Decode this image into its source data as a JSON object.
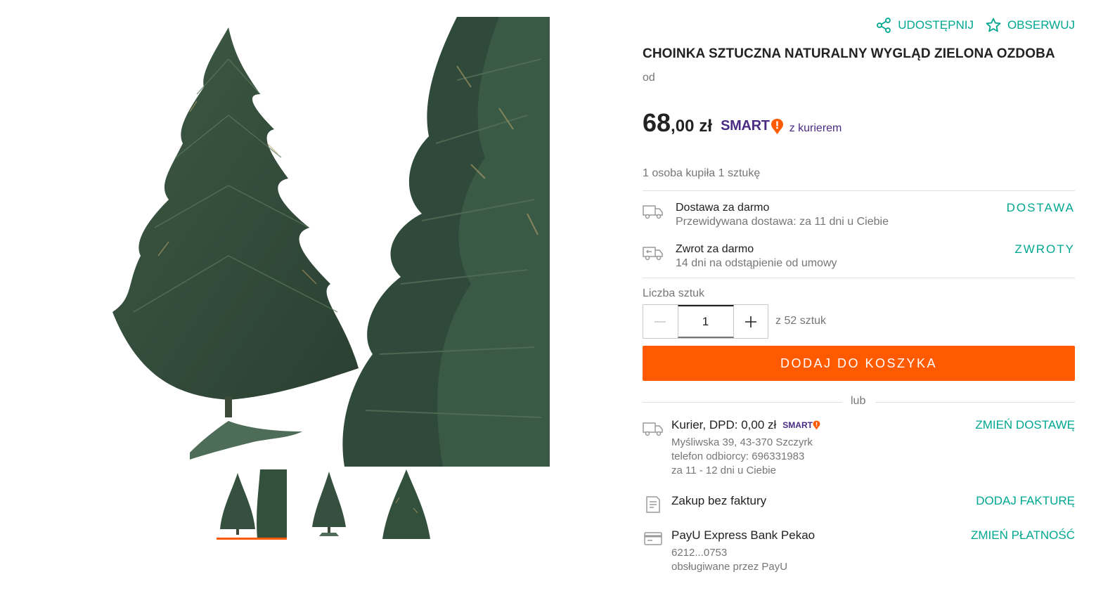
{
  "header": {
    "share_label": "UDOSTĘPNIJ",
    "watch_label": "OBSERWUJ"
  },
  "product": {
    "title": "CHOINKA SZTUCZNA NATURALNY WYGLĄD ZIELONA OZDOBA",
    "from_label": "od",
    "price_int": "68",
    "price_dec": ",00",
    "currency": "zł",
    "smart_brand": "SMART",
    "smart_sub": "z kurierem",
    "bought_info": "1 osoba kupiła 1 sztukę"
  },
  "features": [
    {
      "title": "Dostawa za darmo",
      "subtitle": "Przewidywana dostawa: za 11 dni u Ciebie",
      "link": "DOSTAWA"
    },
    {
      "title": "Zwrot za darmo",
      "subtitle": "14 dni na odstąpienie od umowy",
      "link": "ZWROTY"
    }
  ],
  "quantity": {
    "label": "Liczba sztuk",
    "value": "1",
    "available": "z 52 sztuk"
  },
  "cart": {
    "button_label": "DODAJ DO KOSZYKA",
    "or_label": "lub"
  },
  "delivery": {
    "title": "Kurier, DPD: 0,00 zł",
    "smart_brand": "SMART",
    "address": "Myśliwska 39, 43-370 Szczyrk",
    "phone": "telefon odbiorcy: 696331983",
    "eta": "za 11 - 12 dni u Ciebie",
    "link": "ZMIEŃ DOSTAWĘ"
  },
  "invoice": {
    "title": "Zakup bez faktury",
    "link": "DODAJ FAKTURĘ"
  },
  "payment": {
    "title": "PayU Express Bank Pekao",
    "card": "6212...0753",
    "provider": "obsługiwane przez PayU",
    "link": "ZMIEŃ PŁATNOŚĆ"
  },
  "gallery": {
    "thumbnails": [
      "thumb-1",
      "thumb-2",
      "thumb-3"
    ],
    "active_index": 0
  },
  "colors": {
    "accent": "#00a790",
    "cta": "#ff5a00",
    "smart": "#4a2c85",
    "smart_badge": "#ff5a00"
  }
}
